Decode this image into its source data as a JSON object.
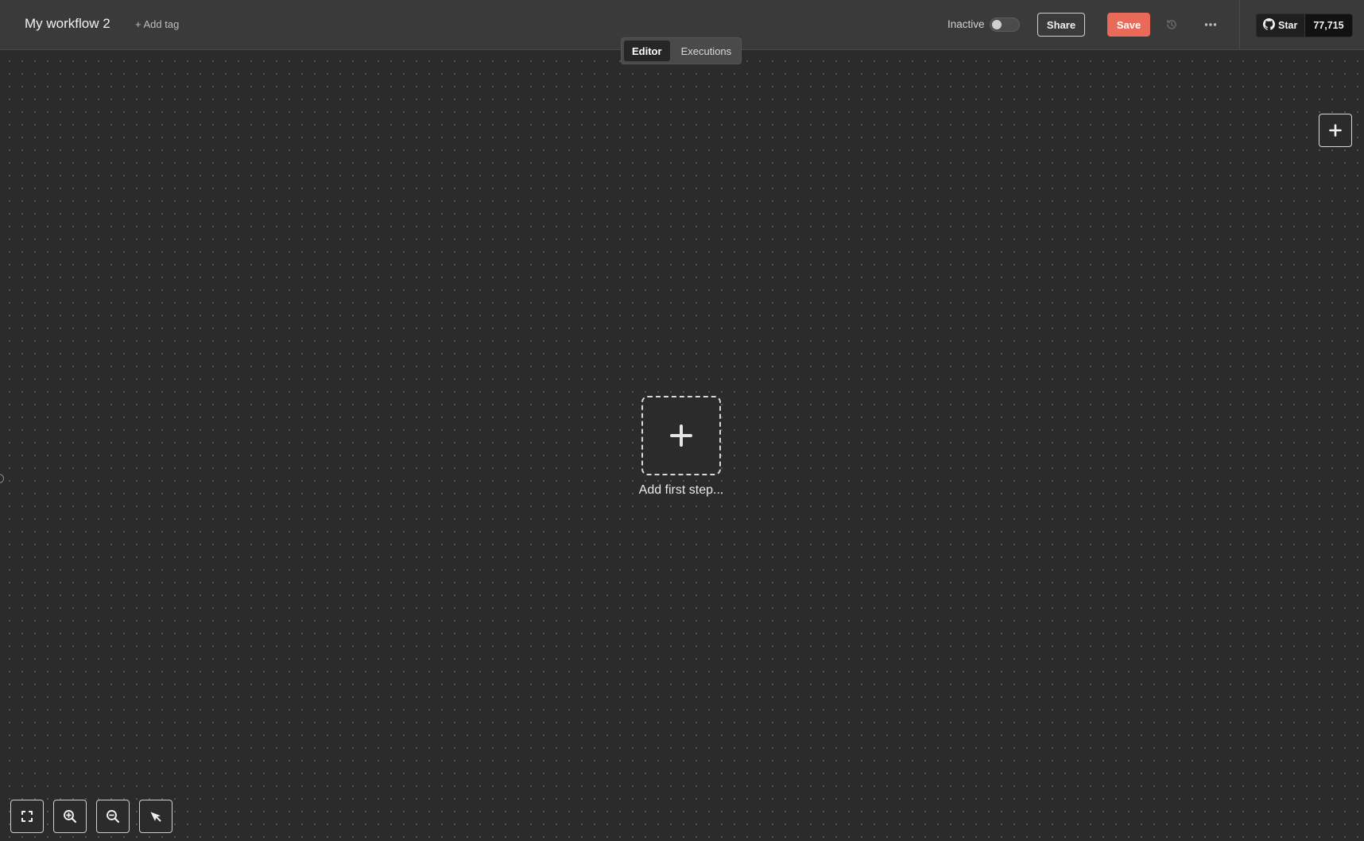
{
  "header": {
    "workflow_title": "My workflow 2",
    "add_tag_label": "+ Add tag",
    "status_label": "Inactive",
    "active_toggle_on": false,
    "share_label": "Share",
    "save_label": "Save",
    "github": {
      "star_label": "Star",
      "star_count": "77,715"
    }
  },
  "tabs": [
    {
      "label": "Editor",
      "active": true
    },
    {
      "label": "Executions",
      "active": false
    }
  ],
  "canvas": {
    "add_first_step_label": "Add first step...",
    "controls": [
      "fit-view-icon",
      "zoom-in-icon",
      "zoom-out-icon",
      "reset-zoom-icon"
    ]
  },
  "colors": {
    "accent_save": "#ea6a5a",
    "canvas_bg": "#2b2b2b",
    "header_bg": "#3a3a3a"
  }
}
